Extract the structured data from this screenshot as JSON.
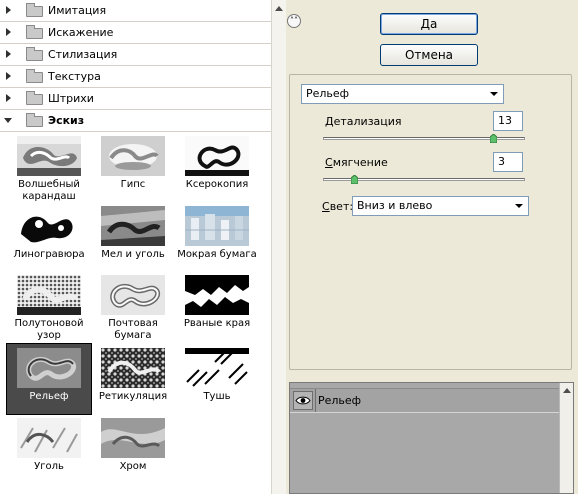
{
  "categories": [
    {
      "label": "Имитация",
      "open": false
    },
    {
      "label": "Искажение",
      "open": false
    },
    {
      "label": "Стилизация",
      "open": false
    },
    {
      "label": "Текстура",
      "open": false
    },
    {
      "label": "Штрихи",
      "open": false
    },
    {
      "label": "Эскиз",
      "open": true
    }
  ],
  "thumbnails": [
    {
      "caption": "Волшебный карандаш",
      "icon": "conte-crayon-thumbnail",
      "selected": false
    },
    {
      "caption": "Гипс",
      "icon": "plaster-thumbnail",
      "selected": false
    },
    {
      "caption": "Ксерокопия",
      "icon": "photocopy-thumbnail",
      "selected": false
    },
    {
      "caption": "Линогравюра",
      "icon": "stamp-thumbnail",
      "selected": false
    },
    {
      "caption": "Мел и уголь",
      "icon": "chalk-charcoal-thumbnail",
      "selected": false
    },
    {
      "caption": "Мокрая бумага",
      "icon": "water-paper-thumbnail",
      "selected": false
    },
    {
      "caption": "Полутоновой узор",
      "icon": "halftone-pattern-thumbnail",
      "selected": false
    },
    {
      "caption": "Почтовая бумага",
      "icon": "note-paper-thumbnail",
      "selected": false
    },
    {
      "caption": "Рваные края",
      "icon": "torn-edges-thumbnail",
      "selected": false
    },
    {
      "caption": "Рельеф",
      "icon": "bas-relief-thumbnail",
      "selected": true
    },
    {
      "caption": "Ретикуляция",
      "icon": "reticulation-thumbnail",
      "selected": false
    },
    {
      "caption": "Тушь",
      "icon": "graphic-pen-thumbnail",
      "selected": false
    },
    {
      "caption": "Уголь",
      "icon": "charcoal-thumbnail",
      "selected": false
    },
    {
      "caption": "Хром",
      "icon": "chrome-thumbnail",
      "selected": false
    }
  ],
  "dialog": {
    "ok_label": "Да",
    "cancel_label": "Отмена",
    "collapse_icon": "double-chevron-up-icon"
  },
  "filter": {
    "selected": "Рельеф",
    "params": {
      "detail": {
        "label_hotkey": "Д",
        "label_rest": "етализация",
        "value": "13",
        "min": 1,
        "max": 15
      },
      "smoothness": {
        "label_hotkey": "С",
        "label_rest": "мягчение",
        "value": "3",
        "min": 1,
        "max": 15
      },
      "light": {
        "label_hotkey": "С",
        "label_rest": "вет:",
        "value": "Вниз и влево"
      }
    }
  },
  "layers": [
    {
      "name": "Рельеф",
      "visible": true,
      "icon": "eye-icon"
    }
  ],
  "colors": {
    "dialog_bg": "#ece9d8",
    "selection": "#4a4a4a",
    "layers_bg": "#a8a8a8",
    "button_border": "#003c74"
  }
}
